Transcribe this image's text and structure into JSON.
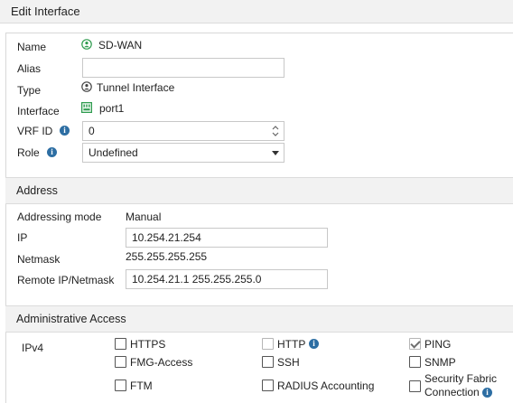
{
  "window": {
    "title": "Edit Interface"
  },
  "form": {
    "name": {
      "label": "Name",
      "value": "SD-WAN",
      "icon": "sdwan-zone-icon"
    },
    "alias": {
      "label": "Alias",
      "value": ""
    },
    "type": {
      "label": "Type",
      "value": "Tunnel Interface",
      "icon": "tunnel-interface-icon"
    },
    "interface": {
      "label": "Interface",
      "value": "port1",
      "icon": "port-icon"
    },
    "vrf_id": {
      "label": "VRF ID",
      "value": "0",
      "icon": "info-icon"
    },
    "role": {
      "label": "Role",
      "value": "Undefined",
      "icon": "info-icon"
    }
  },
  "address": {
    "section_title": "Address",
    "addressing_mode": {
      "label": "Addressing mode",
      "value": "Manual"
    },
    "ip": {
      "label": "IP",
      "value": "10.254.21.254"
    },
    "netmask": {
      "label": "Netmask",
      "value": "255.255.255.255"
    },
    "remote": {
      "label": "Remote IP/Netmask",
      "value": "10.254.21.1 255.255.255.0"
    }
  },
  "admin_access": {
    "section_title": "Administrative Access",
    "ipv4_label": "IPv4",
    "options": [
      {
        "label": "HTTPS",
        "checked": false,
        "enabled": true
      },
      {
        "label": "HTTP",
        "checked": false,
        "enabled": false,
        "info": true
      },
      {
        "label": "PING",
        "checked": true,
        "enabled": false
      },
      {
        "label": "FMG-Access",
        "checked": false,
        "enabled": true
      },
      {
        "label": "SSH",
        "checked": false,
        "enabled": true
      },
      {
        "label": "SNMP",
        "checked": false,
        "enabled": true
      },
      {
        "label": "FTM",
        "checked": false,
        "enabled": true
      },
      {
        "label": "RADIUS Accounting",
        "checked": false,
        "enabled": true
      },
      {
        "label": "Security Fabric Connection",
        "checked": false,
        "enabled": true,
        "info": true
      }
    ]
  },
  "colors": {
    "green_icon": "#2e9b4e",
    "info_blue": "#2d6ea3",
    "section_bg": "#f2f2f2",
    "border": "#c8c8c8"
  }
}
